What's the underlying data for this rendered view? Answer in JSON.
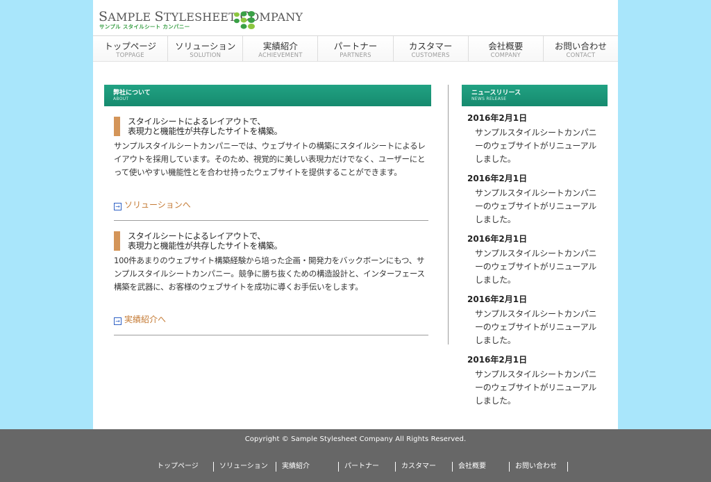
{
  "logo": {
    "text_s": "S",
    "text_ample": "AMPLE ",
    "text_s2": "S",
    "text_tylesheet": "TYLESHEET ",
    "text_c": "C",
    "text_ompany": "OMPANY",
    "subtitle": "サンプル スタイルシート カンパニー",
    "colors": [
      "#3aa046",
      "#8cc63f"
    ]
  },
  "gnav": [
    {
      "jp": "トップページ",
      "en": "TOPPAGE"
    },
    {
      "jp": "ソリューション",
      "en": "SOLUTION"
    },
    {
      "jp": "実績紹介",
      "en": "ACHIEVEMENT"
    },
    {
      "jp": "パートナー",
      "en": "PARTNERS"
    },
    {
      "jp": "カスタマー",
      "en": "CUSTOMERS"
    },
    {
      "jp": "会社概要",
      "en": "COMPANY"
    },
    {
      "jp": "お問い合わせ",
      "en": "CONTACT"
    }
  ],
  "about": {
    "title": "弊社について",
    "title_en": "ABOUT",
    "articles": [
      {
        "headline_1": "スタイルシートによるレイアウトで、",
        "headline_2": "表現力と機能性が共存したサイトを構築。",
        "body": "サンプルスタイルシートカンパニーでは、ウェブサイトの構築にスタイルシートによるレイアウトを採用しています。そのため、視覚的に美しい表現力だけでなく、ユーザーにとって使いやすい機能性とを合わせ持ったウェブサイトを提供することができます。",
        "link": "ソリューションへ"
      },
      {
        "headline_1": "スタイルシートによるレイアウトで、",
        "headline_2": "表現力と機能性が共存したサイトを構築。",
        "body": "100件あまりのウェブサイト構築経験から培った企画・開発力をバックボーンにもつ、サンプルスタイルシートカンパニー。競争に勝ち抜くための構造設計と、インターフェース構築を武器に、お客様のウェブサイトを成功に導くお手伝いをします。",
        "link": "実績紹介へ"
      }
    ]
  },
  "news": {
    "title": "ニュースリリース",
    "title_en": "NEWS RELEASE",
    "items": [
      {
        "date": "2016年2月1日",
        "text": "サンプルスタイルシートカンパニーのウェブサイトがリニューアルしました。"
      },
      {
        "date": "2016年2月1日",
        "text": "サンプルスタイルシートカンパニーのウェブサイトがリニューアルしました。"
      },
      {
        "date": "2016年2月1日",
        "text": "サンプルスタイルシートカンパニーのウェブサイトがリニューアルしました。"
      },
      {
        "date": "2016年2月1日",
        "text": "サンプルスタイルシートカンパニーのウェブサイトがリニューアルしました。"
      },
      {
        "date": "2016年2月1日",
        "text": "サンプルスタイルシートカンパニーのウェブサイトがリニューアルしました。"
      }
    ]
  },
  "footer": {
    "copyright": "Copyright © Sample Stylesheet Company All Rights Reserved.",
    "links": [
      "トップページ",
      "ソリューション",
      "実績紹介",
      "パートナー",
      "カスタマー",
      "会社概要",
      "お問い合わせ"
    ]
  }
}
